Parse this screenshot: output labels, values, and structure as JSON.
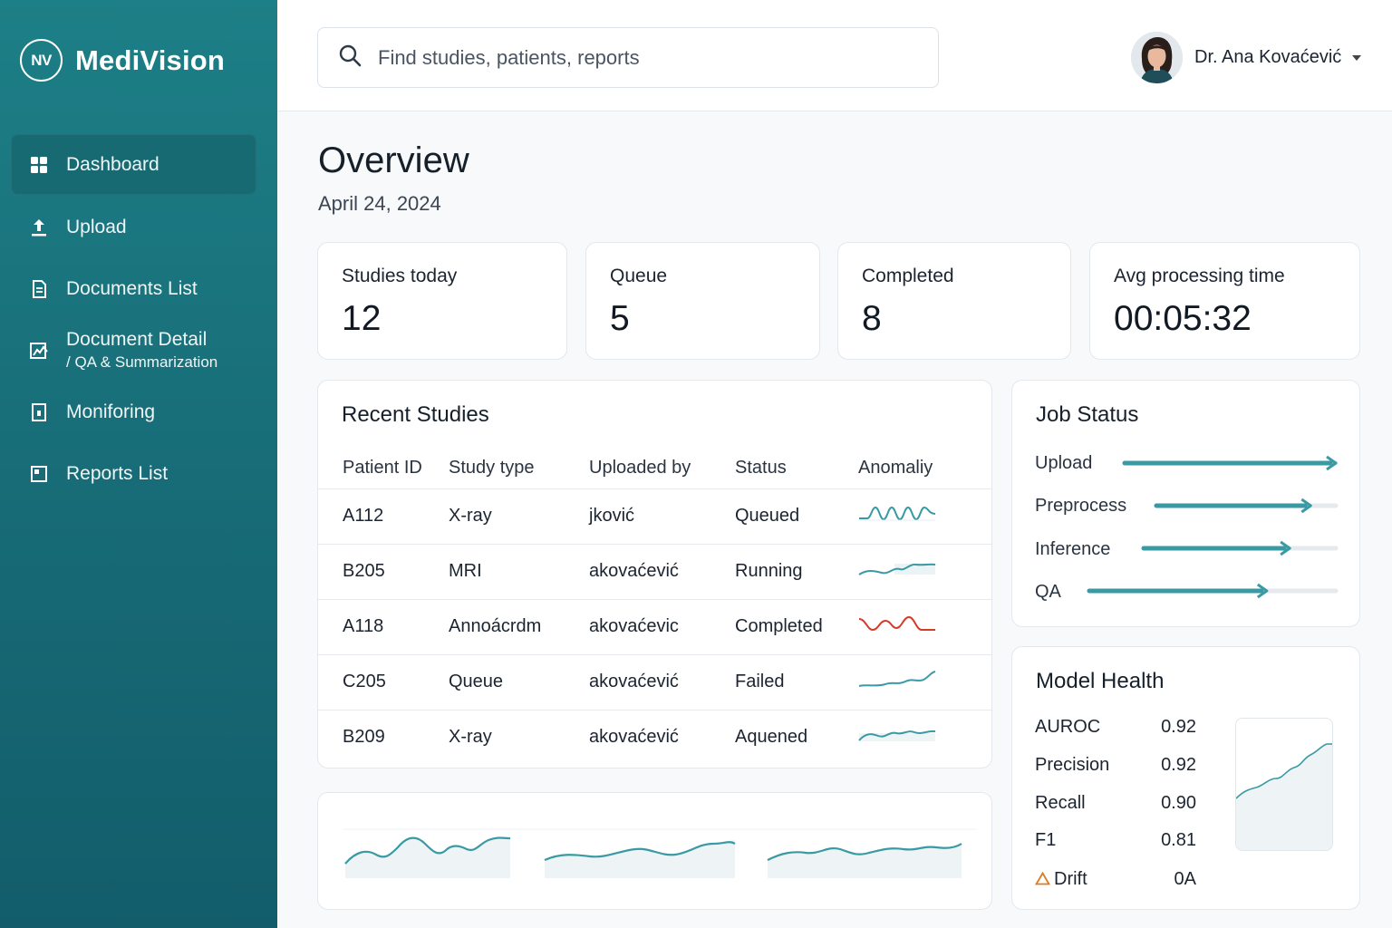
{
  "brand": {
    "logo_text": "NV",
    "name": "MediVision"
  },
  "sidebar": {
    "items": [
      {
        "label": "Dashboard",
        "icon": "dashboard-grid-icon",
        "active": true
      },
      {
        "label": "Upload",
        "icon": "upload-icon"
      },
      {
        "label": "Documents List",
        "icon": "document-icon"
      },
      {
        "label": "Document Detail",
        "sublabel": "/ QA & Summarization",
        "icon": "document-image-icon"
      },
      {
        "label": "Moniforing",
        "icon": "monitor-icon"
      },
      {
        "label": "Reports List",
        "icon": "report-icon"
      }
    ]
  },
  "header": {
    "search": {
      "placeholder": "Find studies, patients, reports",
      "icon": "search-icon"
    },
    "user": {
      "name": "Dr. Ana Kovaćević"
    }
  },
  "overview": {
    "title": "Overview",
    "date": "April 24, 2024"
  },
  "stats": [
    {
      "label": "Studies today",
      "value": "12"
    },
    {
      "label": "Queue",
      "value": "5"
    },
    {
      "label": "Completed",
      "value": "8"
    },
    {
      "label": "Avg processing time",
      "value": "00:05:32"
    }
  ],
  "recent_studies": {
    "title": "Recent Studies",
    "columns": [
      "Patient ID",
      "Study type",
      "Uploaded by",
      "Status",
      "Anomaliy"
    ],
    "rows": [
      {
        "patient_id": "A112",
        "study_type": "X-ray",
        "uploaded_by": "jković",
        "status": "Queued"
      },
      {
        "patient_id": "B205",
        "study_type": "MRI",
        "uploaded_by": "akovaćević",
        "status": "Running"
      },
      {
        "patient_id": "A118",
        "study_type": "Annoácrdm",
        "uploaded_by": "akovaćevic",
        "status": "Completed",
        "status_color": "#d63a2a"
      },
      {
        "patient_id": "C205",
        "study_type": "Queue",
        "uploaded_by": "akovaćević",
        "status": "Failed"
      },
      {
        "patient_id": "B209",
        "study_type": "X-ray",
        "uploaded_by": "akovaćević",
        "status": "Aquened"
      }
    ]
  },
  "job_status": {
    "title": "Job Status",
    "items": [
      {
        "label": "Upload",
        "progress": 1.0
      },
      {
        "label": "Preprocess",
        "progress": 0.86
      },
      {
        "label": "Inference",
        "progress": 0.76
      },
      {
        "label": "QA",
        "progress": 0.72
      }
    ]
  },
  "model_health": {
    "title": "Model Health",
    "metrics": [
      {
        "label": "AUROC",
        "value": "0.92"
      },
      {
        "label": "Precision",
        "value": "0.92"
      },
      {
        "label": "Recall",
        "value": "0.90"
      },
      {
        "label": "F1",
        "value": "0.81"
      },
      {
        "label": "Drift",
        "value": "0A",
        "icon": "warning-triangle-icon"
      }
    ]
  },
  "colors": {
    "sidebar": "#1a7480",
    "accent": "#3a9aa3",
    "danger": "#d63a2a",
    "warning": "#e07a1f"
  }
}
